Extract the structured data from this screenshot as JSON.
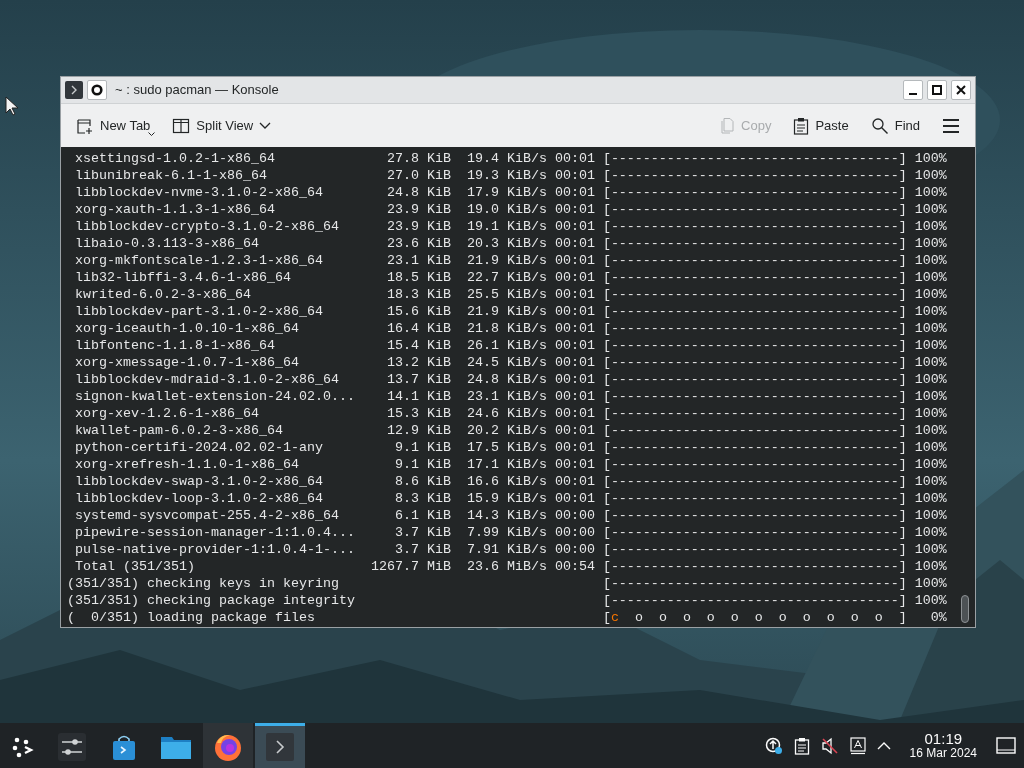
{
  "window": {
    "title": "~ : sudo pacman — Konsole"
  },
  "toolbar": {
    "left": [
      {
        "kind": "new-tab",
        "label": "New Tab",
        "dropdown": true
      },
      {
        "kind": "split-view",
        "label": "Split View",
        "dropdown": true
      }
    ],
    "right": [
      {
        "kind": "copy",
        "label": "Copy",
        "disabled": true
      },
      {
        "kind": "paste",
        "label": "Paste",
        "disabled": false
      },
      {
        "kind": "find",
        "label": "Find",
        "disabled": false
      },
      {
        "kind": "menu",
        "disabled": false
      }
    ]
  },
  "terminal": {
    "lines": [
      {
        "text": " xsettingsd-1.0.2-1-x86_64              27.8 KiB  19.4 KiB/s 00:01 [------------------------------------] 100%"
      },
      {
        "text": " libunibreak-6.1-1-x86_64               27.0 KiB  19.3 KiB/s 00:01 [------------------------------------] 100%"
      },
      {
        "text": " libblockdev-nvme-3.1.0-2-x86_64        24.8 KiB  17.9 KiB/s 00:01 [------------------------------------] 100%"
      },
      {
        "text": " xorg-xauth-1.1.3-1-x86_64              23.9 KiB  19.0 KiB/s 00:01 [------------------------------------] 100%"
      },
      {
        "text": " libblockdev-crypto-3.1.0-2-x86_64      23.9 KiB  19.1 KiB/s 00:01 [------------------------------------] 100%"
      },
      {
        "text": " libaio-0.3.113-3-x86_64                23.6 KiB  20.3 KiB/s 00:01 [------------------------------------] 100%"
      },
      {
        "text": " xorg-mkfontscale-1.2.3-1-x86_64        23.1 KiB  21.9 KiB/s 00:01 [------------------------------------] 100%"
      },
      {
        "text": " lib32-libffi-3.4.6-1-x86_64            18.5 KiB  22.7 KiB/s 00:01 [------------------------------------] 100%"
      },
      {
        "text": " kwrited-6.0.2-3-x86_64                 18.3 KiB  25.5 KiB/s 00:01 [------------------------------------] 100%"
      },
      {
        "text": " libblockdev-part-3.1.0-2-x86_64        15.6 KiB  21.9 KiB/s 00:01 [------------------------------------] 100%"
      },
      {
        "text": " xorg-iceauth-1.0.10-1-x86_64           16.4 KiB  21.8 KiB/s 00:01 [------------------------------------] 100%"
      },
      {
        "text": " libfontenc-1.1.8-1-x86_64              15.4 KiB  26.1 KiB/s 00:01 [------------------------------------] 100%"
      },
      {
        "text": " xorg-xmessage-1.0.7-1-x86_64           13.2 KiB  24.5 KiB/s 00:01 [------------------------------------] 100%"
      },
      {
        "text": " libblockdev-mdraid-3.1.0-2-x86_64      13.7 KiB  24.8 KiB/s 00:01 [------------------------------------] 100%"
      },
      {
        "text": " signon-kwallet-extension-24.02.0...    14.1 KiB  23.1 KiB/s 00:01 [------------------------------------] 100%"
      },
      {
        "text": " xorg-xev-1.2.6-1-x86_64                15.3 KiB  24.6 KiB/s 00:01 [------------------------------------] 100%"
      },
      {
        "text": " kwallet-pam-6.0.2-3-x86_64             12.9 KiB  20.2 KiB/s 00:01 [------------------------------------] 100%"
      },
      {
        "text": " python-certifi-2024.02.02-1-any         9.1 KiB  17.5 KiB/s 00:01 [------------------------------------] 100%"
      },
      {
        "text": " xorg-xrefresh-1.1.0-1-x86_64            9.1 KiB  17.1 KiB/s 00:01 [------------------------------------] 100%"
      },
      {
        "text": " libblockdev-swap-3.1.0-2-x86_64         8.6 KiB  16.6 KiB/s 00:01 [------------------------------------] 100%"
      },
      {
        "text": " libblockdev-loop-3.1.0-2-x86_64         8.3 KiB  15.9 KiB/s 00:01 [------------------------------------] 100%"
      },
      {
        "text": " systemd-sysvcompat-255.4-2-x86_64       6.1 KiB  14.3 KiB/s 00:00 [------------------------------------] 100%"
      },
      {
        "text": " pipewire-session-manager-1:1.0.4...     3.7 KiB  7.99 KiB/s 00:00 [------------------------------------] 100%"
      },
      {
        "text": " pulse-native-provider-1:1.0.4-1-...     3.7 KiB  7.91 KiB/s 00:00 [------------------------------------] 100%"
      },
      {
        "text": " Total (351/351)                      1267.7 MiB  23.6 MiB/s 00:54 [------------------------------------] 100%"
      },
      {
        "text": "(351/351) checking keys in keyring                                 [------------------------------------] 100%"
      },
      {
        "text": "(351/351) checking package integrity                               [------------------------------------] 100%"
      },
      {
        "text": "(  0/351) loading package files                                    [",
        "highlight": "c",
        "rest": "  o  o  o  o  o  o  o  o  o  o  o  ]   0%"
      }
    ]
  },
  "taskbar": {
    "apps": [
      {
        "kind": "launcher",
        "running": false,
        "selected": false
      },
      {
        "kind": "settings",
        "running": false,
        "selected": false
      },
      {
        "kind": "store",
        "running": false,
        "selected": false
      },
      {
        "kind": "files",
        "running": false,
        "selected": false
      },
      {
        "kind": "browser",
        "running": true,
        "selected": false
      },
      {
        "kind": "terminal",
        "running": true,
        "selected": true
      }
    ],
    "tray": [
      {
        "kind": "updates"
      },
      {
        "kind": "clipboard"
      },
      {
        "kind": "volume",
        "muted": true
      },
      {
        "kind": "input-method"
      },
      {
        "kind": "expand"
      }
    ],
    "clock": {
      "time": "01:19",
      "date": "16 Mar 2024"
    }
  }
}
